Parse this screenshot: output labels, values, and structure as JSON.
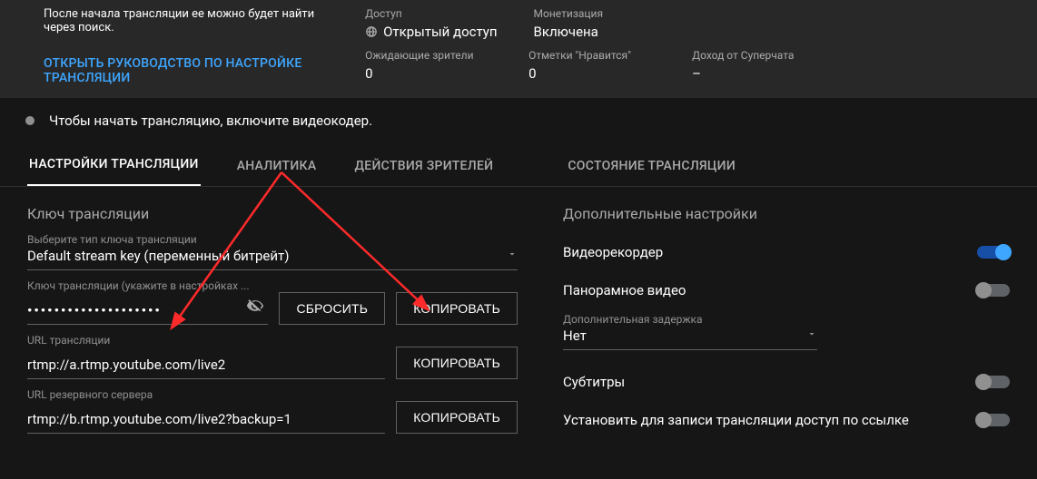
{
  "top": {
    "hint": "После начала трансляции ее можно будет найти через поиск.",
    "guide_link": "ОТКРЫТЬ РУКОВОДСТВО ПО НАСТРОЙКЕ ТРАНСЛЯЦИИ",
    "access_label": "Доступ",
    "access_value": "Открытый доступ",
    "monetization_label": "Монетизация",
    "monetization_value": "Включена",
    "waiting_label": "Ожидающие зрители",
    "waiting_value": "0",
    "likes_label": "Отметки \"Нравится\"",
    "likes_value": "0",
    "superchat_label": "Доход от Суперчата",
    "superchat_value": "–"
  },
  "status": {
    "text": "Чтобы начать трансляцию, включите видеокодер."
  },
  "tabs": {
    "settings": "НАСТРОЙКИ ТРАНСЛЯЦИИ",
    "analytics": "АНАЛИТИКА",
    "viewer_actions": "ДЕЙСТВИЯ ЗРИТЕЛЕЙ",
    "stream_status": "СОСТОЯНИЕ ТРАНСЛЯЦИИ"
  },
  "left": {
    "section_title": "Ключ трансляции",
    "key_type_label": "Выберите тип ключа трансляции",
    "key_type_value": "Default stream key (переменный битрейт)",
    "stream_key_label": "Ключ трансляции (укажите в настройках ...",
    "stream_key_value": "••••••••••••••••••••",
    "reset_btn": "СБРОСИТЬ",
    "copy_btn": "КОПИРОВАТЬ",
    "url_label": "URL трансляции",
    "url_value": "rtmp://a.rtmp.youtube.com/live2",
    "backup_label": "URL резервного сервера",
    "backup_value": "rtmp://b.rtmp.youtube.com/live2?backup=1"
  },
  "right": {
    "section_title": "Дополнительные настройки",
    "dvr_label": "Видеорекордер",
    "pano_label": "Панорамное видео",
    "latency_caption": "Дополнительная задержка",
    "latency_value": "Нет",
    "subtitles_label": "Субтитры",
    "unlisted_label": "Установить для записи трансляции доступ по ссылке"
  }
}
